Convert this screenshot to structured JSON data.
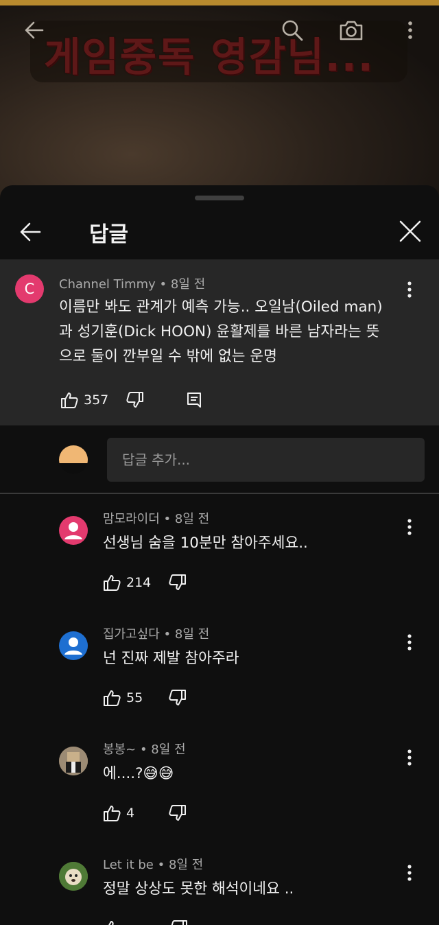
{
  "video": {
    "title_overlay": "게임중독 영감님..."
  },
  "top_icons": [
    "back-arrow-icon",
    "search-icon",
    "camera-icon",
    "more-vertical-icon"
  ],
  "sheet": {
    "title": "답글"
  },
  "parent_comment": {
    "avatar_letter": "C",
    "avatar_color": "#e33a6e",
    "author": "Channel Timmy",
    "time": "8일 전",
    "text_lines": [
      "이름만 봐도 관계가 예측 가능.. 오일남(Oiled man)",
      "과 성기훈(Dick HOON) 윤활제를 바른 남자라는 뜻",
      "으로 둘이 깐부일 수 밖에 없는 운명"
    ],
    "likes": "357"
  },
  "reply_box": {
    "placeholder": "답글 추가..."
  },
  "replies": [
    {
      "author": "맘모라이더",
      "time": "8일 전",
      "text": "선생님 숨을 10분만 참아주세요..",
      "likes": "214",
      "avatar_color": "#e33a6e"
    },
    {
      "author": "집가고싶다",
      "time": "8일 전",
      "text": "넌 진짜 제발 참아주라",
      "likes": "55",
      "avatar_color": "#1e6fd1"
    },
    {
      "author": "봉봉~",
      "time": "8일 전",
      "text": "에....?😅😅",
      "likes": "4",
      "avatar_color": "#8a7a66"
    },
    {
      "author": "Let it be",
      "time": "8일 전",
      "text": "정말 상상도 못한 해석이네요 ..",
      "likes": "",
      "avatar_color": "#5f7d3b"
    }
  ],
  "colors": {
    "background": "#0f0f0f",
    "surface": "#272727",
    "text_primary": "#f1f1f1",
    "text_secondary": "#aaaaaa"
  }
}
